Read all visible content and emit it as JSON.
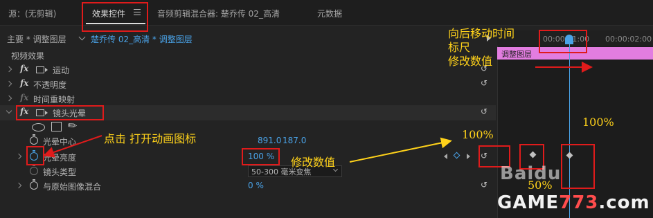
{
  "tabs": {
    "source": "源：(无剪辑)",
    "effect_controls": "效果控件",
    "audio_mixer": "音频剪辑混合器: 楚乔传 02_高清",
    "metadata": "元数据"
  },
  "clip_selector": {
    "master": "主要 * 调整图层",
    "sequence": "楚乔传 02_高清 * 调整图层"
  },
  "section_title": "视频效果",
  "effects": {
    "motion": "运动",
    "opacity": "不透明度",
    "time_remap": "时间重映射",
    "lens_flare": "镜头光晕"
  },
  "properties": {
    "flare_center": {
      "label": "光晕中心",
      "x": "891.0",
      "y": "187.0"
    },
    "flare_brightness": {
      "label": "光晕亮度",
      "value": "100 %"
    },
    "lens_type": {
      "label": "镜头类型",
      "value": "50-300 毫米变焦"
    },
    "blend": {
      "label": "与原始图像混合",
      "value": "0 %"
    }
  },
  "timeline": {
    "tc1": "00:00:01:00",
    "tc2": "00:00:02:00",
    "clip_label": "调整图层"
  },
  "annotations": {
    "move_time_1": "向后移动时间",
    "move_time_2": "标尺",
    "modify_top": "修改数值",
    "click_note": "点击  打开动画图标",
    "modify_mid": "修改数值",
    "pct_left": "100%",
    "pct_right": "100%",
    "pct_bottom": "50%"
  },
  "watermarks": {
    "baidu": "Baidu",
    "game_a": "GAME",
    "game_b": "773",
    "game_c": ".com"
  },
  "colors": {
    "accent_blue": "#4aa3e8",
    "annotation_red": "#e01b1b",
    "annotation_yellow": "#ffd21a",
    "clip_pink": "#e27de0"
  },
  "icons": [
    "menu-icon",
    "fx-icon",
    "motion-icon",
    "stopwatch-icon",
    "reset-icon",
    "ellipse-mask-icon",
    "rect-mask-icon",
    "pen-mask-icon",
    "play-icon",
    "keyframe-icon"
  ]
}
